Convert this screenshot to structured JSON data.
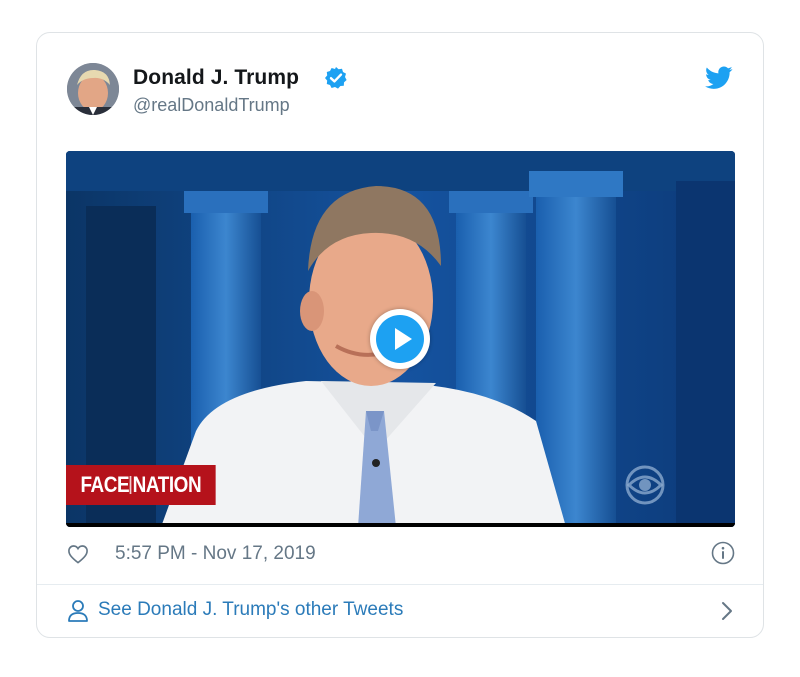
{
  "tweet": {
    "author": {
      "display_name": "Donald J. Trump",
      "handle": "@realDonaldTrump",
      "verified": true,
      "avatar_icon": "avatar-photo"
    },
    "brand_icon": "twitter-bird-icon",
    "media": {
      "type": "video",
      "show_logo": {
        "left": "FACE",
        "right": "NATION"
      },
      "network_icon": "cbs-eye-icon",
      "play_icon": "play-icon"
    },
    "timestamp": "5:57 PM - Nov 17, 2019",
    "like_icon": "heart-icon",
    "info_icon": "info-icon",
    "footer": {
      "label": "See Donald J. Trump's other Tweets",
      "icon": "person-icon"
    }
  },
  "colors": {
    "accent": "#1da1f2",
    "link": "#2b7bb9",
    "muted": "#657786",
    "border": "#dfe3e6",
    "logo_red": "#b5121b"
  }
}
